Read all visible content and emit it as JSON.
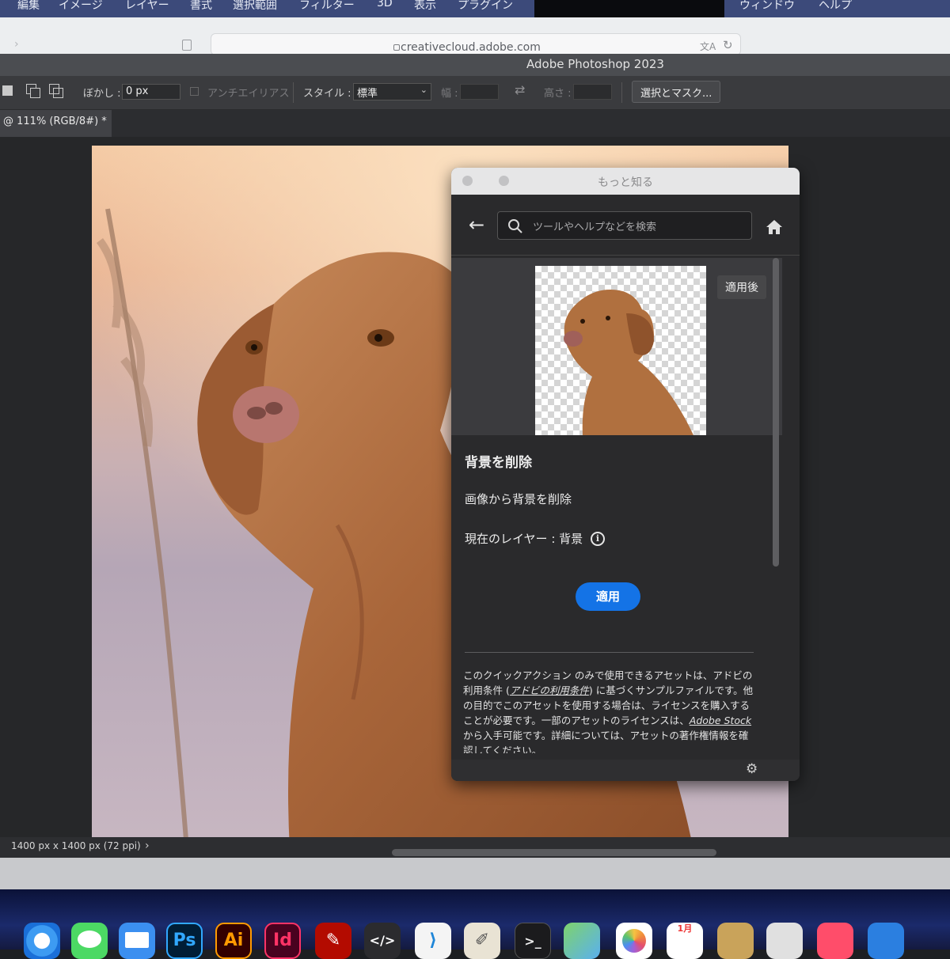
{
  "menubar": {
    "items": [
      "編集",
      "イメージ",
      "レイヤー",
      "書式",
      "選択範囲",
      "フィルター",
      "3D",
      "表示",
      "プラグイン",
      "ウィンドウ",
      "ヘルプ"
    ]
  },
  "browser": {
    "url": "creativecloud.adobe.com"
  },
  "app": {
    "title": "Adobe Photoshop 2023"
  },
  "options_bar": {
    "feather_label": "ぼかし :",
    "feather_value": "0 px",
    "antialias_label": "アンチエイリアス",
    "style_label": "スタイル :",
    "style_value": "標準",
    "width_label": "幅 :",
    "height_label": "高さ :",
    "select_mask_label": "選択とマスク..."
  },
  "document": {
    "tab_label": "@ 111% (RGB/8#) *"
  },
  "status": {
    "doc_size": "1400 px x 1400 px (72 ppi)",
    "arrow": "›"
  },
  "learn_panel": {
    "title": "もっと知る",
    "search_placeholder": "ツールやヘルプなどを検索",
    "after_badge": "適用後",
    "heading": "背景を削除",
    "description": "画像から背景を削除",
    "current_layer": "現在のレイヤー : 背景",
    "apply_label": "適用",
    "legal": {
      "part1": "このクイックアクション のみで使用できるアセットは、アドビの利用条件 (",
      "terms_link": "アドビの利用条件",
      "part2": ") に基づくサンプルファイルです。他の目的でこのアセットを使用する場合は、ライセンスを購入することが必要です。一部のアセットのライセンスは、",
      "stock_link": "Adobe Stock",
      "part3": " から入手可能です。詳細については、アセットの著作権情報を確認してください。"
    }
  },
  "dock": {
    "apps": [
      {
        "name": "safari",
        "label": ""
      },
      {
        "name": "messages",
        "label": ""
      },
      {
        "name": "mail",
        "label": ""
      },
      {
        "name": "photoshop",
        "label": "Ps"
      },
      {
        "name": "illustrator",
        "label": "Ai"
      },
      {
        "name": "indesign",
        "label": "Id"
      },
      {
        "name": "acrobat",
        "label": ""
      },
      {
        "name": "script-editor",
        "label": "</>"
      },
      {
        "name": "vscode",
        "label": ""
      },
      {
        "name": "textedit",
        "label": ""
      },
      {
        "name": "terminal",
        "label": ">_"
      },
      {
        "name": "maps",
        "label": ""
      },
      {
        "name": "photos",
        "label": ""
      },
      {
        "name": "calendar",
        "label": "1月"
      }
    ]
  },
  "colors": {
    "accent_blue": "#1473e6",
    "panel_bg": "#2a2a2c",
    "ps_bg": "#001e36",
    "ai_bg": "#330000",
    "id_bg": "#49021f"
  }
}
